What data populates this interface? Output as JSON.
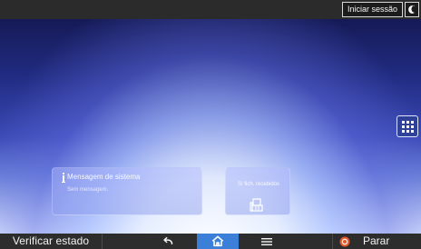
{
  "top_bar": {
    "login_label": "Iniciar sessão",
    "energy_icon": "moon-icon"
  },
  "home_screen": {
    "apps_icon": "grid-icon",
    "system_message": {
      "icon": "info-icon",
      "title": "Mensagem de sistema",
      "subtitle": "Sem mensagem."
    },
    "fax_widget": {
      "title": "S/ fich. recebidos",
      "icon": "fax-document-icon"
    },
    "page_indicators": [
      "left-page-indicator-icon",
      "right-page-indicator-icon"
    ]
  },
  "bottom_bar": {
    "status_label": "Verificar estado",
    "back_icon": "back-arrow-icon",
    "home_icon": "home-icon",
    "menu_icon": "menu-icon",
    "stop_icon": "stop-icon",
    "stop_label": "Parar"
  },
  "colors": {
    "top_bar": "#2b2b2b",
    "bottom_bar": "#2d2d2d",
    "home_active": "#3b7fd9",
    "stop_red": "#e35a2f"
  }
}
